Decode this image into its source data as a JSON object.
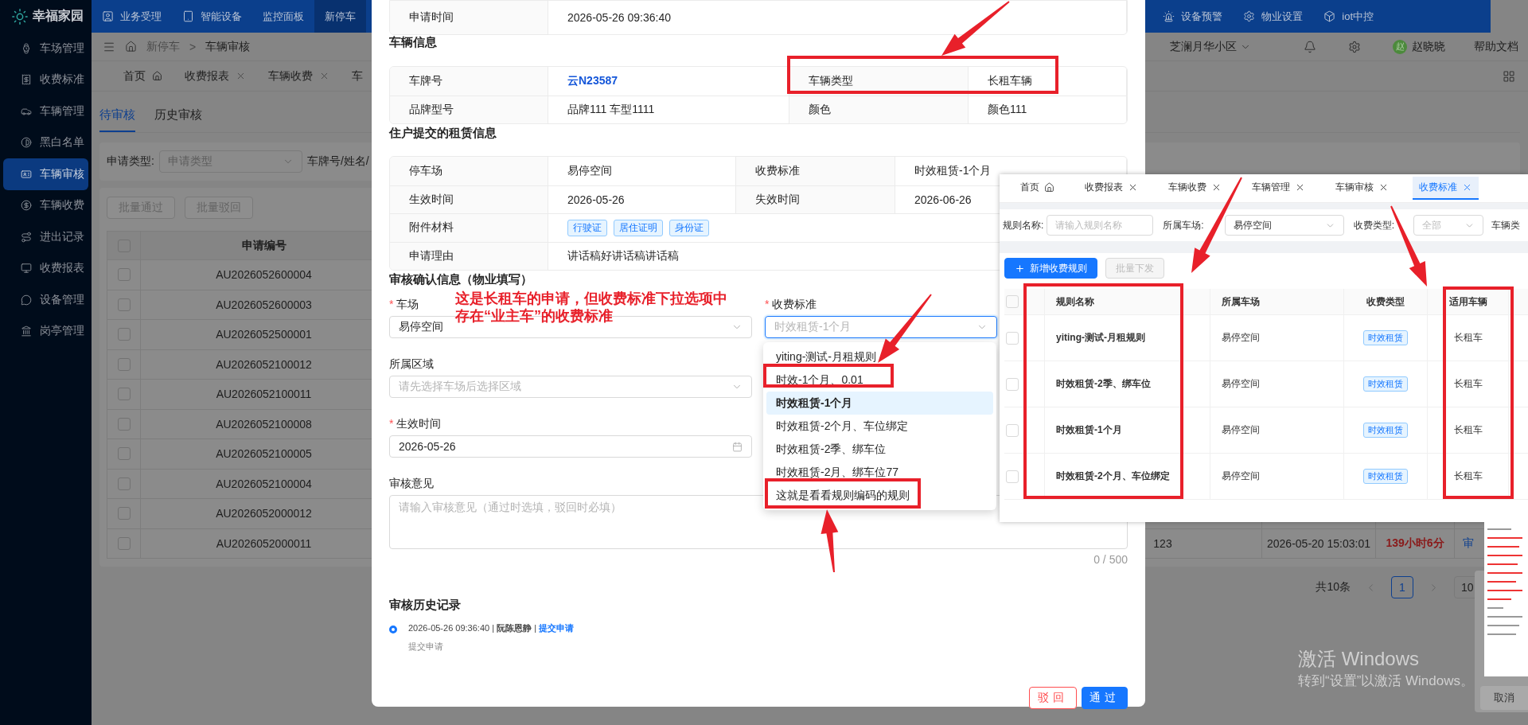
{
  "sidebar": {
    "brand": "幸福家园",
    "items": [
      {
        "label": "车场管理",
        "selected": false
      },
      {
        "label": "收费标准",
        "selected": false
      },
      {
        "label": "车辆管理",
        "selected": false
      },
      {
        "label": "黑白名单",
        "selected": false
      },
      {
        "label": "车辆审核",
        "selected": true
      },
      {
        "label": "车辆收费",
        "selected": false
      },
      {
        "label": "进出记录",
        "selected": false
      },
      {
        "label": "收费报表",
        "selected": false
      },
      {
        "label": "设备管理",
        "selected": false
      },
      {
        "label": "岗亭管理",
        "selected": false
      }
    ]
  },
  "top_nav": {
    "items": [
      {
        "label": "业务受理",
        "selected": false
      },
      {
        "label": "智能设备",
        "selected": false
      },
      {
        "label": "监控面板",
        "selected": false
      },
      {
        "label": "新停车",
        "selected": true
      }
    ],
    "right_items": [
      {
        "label": "设备预警"
      },
      {
        "label": "物业设置"
      },
      {
        "label": "iot中控"
      }
    ]
  },
  "header": {
    "breadcrumb": [
      {
        "label": "新停车",
        "current": false
      },
      {
        "label": "车辆审核",
        "current": true
      }
    ],
    "separator": ">",
    "community": "芝澜月华小区",
    "avatar": "赵",
    "user": "赵晓晓",
    "help": "帮助文档"
  },
  "page_tabs": [
    {
      "label": "首页",
      "kind": "home"
    },
    {
      "label": "收费报表",
      "kind": "closable"
    },
    {
      "label": "车辆收费",
      "kind": "closable"
    },
    {
      "label": "车",
      "kind": "plain"
    }
  ],
  "review_tabs": [
    {
      "label": "待审核",
      "selected": true
    },
    {
      "label": "历史审核",
      "selected": false
    }
  ],
  "filter": {
    "label": "申请类型:",
    "placeholder": "申请类型",
    "next_label": "车牌号/姓名/"
  },
  "batch_buttons": [
    {
      "label": "批量通过",
      "disabled": true
    },
    {
      "label": "批量驳回",
      "disabled": true
    }
  ],
  "table": {
    "columns": [
      "申请编号"
    ],
    "all_checked": false,
    "rows": [
      {
        "id": "AU2026052600004",
        "checked": false
      },
      {
        "id": "AU2026052600003",
        "checked": false
      },
      {
        "id": "AU2026052500001",
        "checked": false
      },
      {
        "id": "AU2026052100012",
        "checked": false
      },
      {
        "id": "AU2026052100011",
        "checked": false
      },
      {
        "id": "AU2026052100008",
        "checked": false
      },
      {
        "id": "AU2026052100005",
        "checked": false
      },
      {
        "id": "AU2026052100004",
        "checked": false
      },
      {
        "id": "AU2026052000012",
        "checked": false
      },
      {
        "id": "AU2026052000011",
        "checked": false,
        "column_3": "123",
        "column_4": "2026-05-20 15:03:01",
        "column_5": "139小时6分",
        "column_6": "审"
      }
    ]
  },
  "pagination": {
    "total": "共10条",
    "pages": [
      {
        "label": "1",
        "selected": true
      }
    ],
    "page_size": "10"
  },
  "modal": {
    "top_row": {
      "label": "申请时间",
      "value": "2026-05-26 09:36:40"
    },
    "vehicle": {
      "title": "车辆信息",
      "rows": [
        [
          {
            "label": "车牌号",
            "value": "云N23587",
            "emphasis": true
          },
          {
            "label": "车辆类型",
            "value": "长租车辆",
            "emphasis": false
          }
        ],
        [
          {
            "label": "品牌型号",
            "value": "品牌111 车型1111",
            "emphasis": false
          },
          {
            "label": "颜色",
            "value": "颜色111",
            "emphasis": false
          }
        ]
      ]
    },
    "lease": {
      "title": "住户提交的租赁信息",
      "rows": [
        [
          {
            "label": "停车场",
            "value": "易停空间"
          },
          {
            "label": "收费标准",
            "value": "时效租赁-1个月"
          }
        ],
        [
          {
            "label": "生效时间",
            "value": "2026-05-26"
          },
          {
            "label": "失效时间",
            "value": "2026-06-26"
          }
        ],
        [
          {
            "label": "附件材料",
            "tags": [
              "行驶证",
              "居住证明",
              "身份证"
            ]
          }
        ],
        [
          {
            "label": "申请理由",
            "value": "讲话稿好讲话稿讲话稿"
          }
        ]
      ]
    },
    "review": {
      "title": "审核确认信息（物业填写）",
      "required_mark": "*",
      "fields": [
        {
          "label": "车场",
          "required": true,
          "kind": "select",
          "value": "易停空间",
          "focused": false
        },
        {
          "label": "收费标准",
          "required": true,
          "kind": "select",
          "placeholder": "时效租赁-1个月",
          "focused": true,
          "options": [
            {
              "label": "yiting-测试-月租规则",
              "selected": false
            },
            {
              "label": "时效-1个月、0.01",
              "selected": false
            },
            {
              "label": "时效租赁-1个月",
              "selected": true
            },
            {
              "label": "时效租赁-2个月、车位绑定",
              "selected": false
            },
            {
              "label": "时效租赁-2季、绑车位",
              "selected": false
            },
            {
              "label": "时效租赁-2月、绑车位77",
              "selected": false
            },
            {
              "label": "这就是看看规则编码的规则",
              "selected": false
            }
          ]
        },
        {
          "label": "所属区域",
          "required": false,
          "kind": "select",
          "placeholder": "请先选择车场后选择区域",
          "focused": false
        },
        {
          "label": "生效时间",
          "required": true,
          "kind": "date",
          "value": "2026-05-26",
          "focused": false
        },
        {
          "label": "审核意见",
          "required": false,
          "kind": "textarea",
          "placeholder": "请输入审核意见（通过时选填，驳回时必填）",
          "counter": "0 / 500",
          "focused": false
        }
      ]
    },
    "history": {
      "title": "审核历史记录",
      "entries": [
        {
          "line": "2026-05-26 09:36:40 | **阮陈恩静** | ",
          "action": "提交申请",
          "note": "提交申请"
        }
      ]
    },
    "buttons": [
      {
        "label": "驳回",
        "kind": "reject"
      },
      {
        "label": "通过",
        "kind": "approve"
      }
    ]
  },
  "annotation": {
    "lines": [
      "这是长租车的申请，但收费标准下拉选项中",
      "存在“业主车”的收费标准"
    ]
  },
  "pasted": {
    "tabs": [
      {
        "label": "首页",
        "kind": "home",
        "selected": false
      },
      {
        "label": "收费报表",
        "kind": "closable",
        "selected": false
      },
      {
        "label": "车辆收费",
        "kind": "closable",
        "selected": false
      },
      {
        "label": "车辆管理",
        "kind": "closable",
        "selected": false
      },
      {
        "label": "车辆审核",
        "kind": "closable",
        "selected": false
      },
      {
        "label": "收费标准",
        "kind": "closable",
        "selected": true
      }
    ],
    "filters": [
      {
        "label": "规则名称:",
        "kind": "input",
        "placeholder": "请输入规则名称"
      },
      {
        "label": "所属车场:",
        "kind": "select",
        "value": "易停空间"
      },
      {
        "label": "收费类型:",
        "kind": "select",
        "placeholder": "全部"
      },
      {
        "label": "车辆类",
        "kind": "label"
      }
    ],
    "buttons": [
      {
        "label": "新增收费规则",
        "kind": "primary"
      },
      {
        "label": "批量下发",
        "kind": "disabled"
      }
    ],
    "table": {
      "columns": [
        "规则名称",
        "所属车场",
        "收费类型",
        "适用车辆"
      ],
      "all_checked": false,
      "rows": [
        {
          "name": "yiting-测试-月租规则",
          "lot": "易停空间",
          "type": "时效租赁",
          "vehicle": "长租车",
          "checked": false
        },
        {
          "name": "时效租赁-2季、绑车位",
          "lot": "易停空间",
          "type": "时效租赁",
          "vehicle": "长租车",
          "checked": false
        },
        {
          "name": "时效租赁-1个月",
          "lot": "易停空间",
          "type": "时效租赁",
          "vehicle": "长租车",
          "checked": false
        },
        {
          "name": "时效租赁-2个月、车位绑定",
          "lot": "易停空间",
          "type": "时效租赁",
          "vehicle": "长租车",
          "checked": false
        }
      ]
    }
  },
  "side_dialog": {
    "button": "取消"
  },
  "windows_notice": {
    "title": "激活 Windows",
    "hint": "转到“设置”以激活 Windows。"
  }
}
